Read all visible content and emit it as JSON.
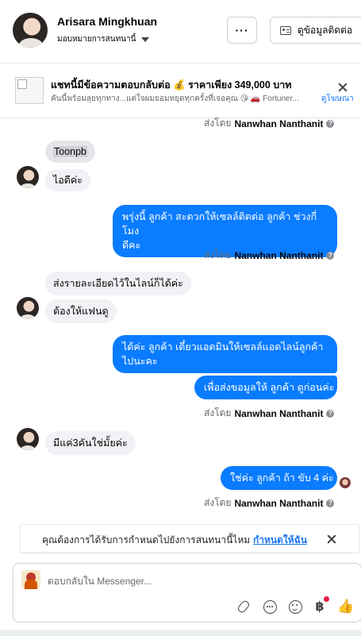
{
  "header": {
    "name": "Arisara Mingkhuan",
    "assign_label": "มอบหมายการสนทนานี้",
    "more_label": "···",
    "contact_label": "ดูข้อมูลติดต่อ"
  },
  "ad": {
    "title": "แชทนี้มีข้อความตอบกลับต่อ 💰 ราคาเพียง 349,000 บาท",
    "subtitle": "คันนี้พร้อมลุยทุกทาง...แต่ใจผมยอมหยุดทุกครั้งที่เจอคุณ 😘 🚗 Fortuner...",
    "link_label": "ดูโฆษณา"
  },
  "messages": {
    "sent_by_prefix": "ส่งโดย",
    "sender": "Nanwhan Nanthanit",
    "info_glyph": "?",
    "in1": "Toonpb",
    "in2": "ไอดีค่ะ",
    "out1_line1": "พรุ่งนี้ ลูกค้า สะดวกให้เซลล์ติดต่อ ลูกค้า ช่วงกี่โมง",
    "out1_line2": "ดีคะ",
    "in3": "ส่งรายละเอียดไว้ในไลน์ก็ได้ค่ะ",
    "in4": "ต้องให้แฟนดู",
    "out2_line1": "ได้ค่ะ ลูกค้า เดี๋ยวแอดมินให้เซลล์แอดไลน์ลูกค้า",
    "out2_line2": "ไปนะคะ",
    "out3": "เพื่อส่งขอมูลให้ ลูกค้า ดูก่อนค่ะ",
    "in5": "มีแค่3คันใช่มั้ยค่ะ",
    "out4": "ใช่ค่ะ ลูกค้า ถ้า ขับ 4 ค่ะ"
  },
  "notice": {
    "text": "คุณต้องการได้รับการกำหนดไปยังการสนทนานี้ไหม",
    "link": "กำหนดให้ฉัน"
  },
  "composer": {
    "placeholder": "ตอบกลับใน Messenger...",
    "baht_glyph": "฿",
    "like_glyph": "👍"
  },
  "colors": {
    "outgoing_bubble": "#0a7cff",
    "incoming_bubble": "#f0f2f5",
    "link": "#1877f2",
    "notification_dot": "#e41e3f"
  }
}
